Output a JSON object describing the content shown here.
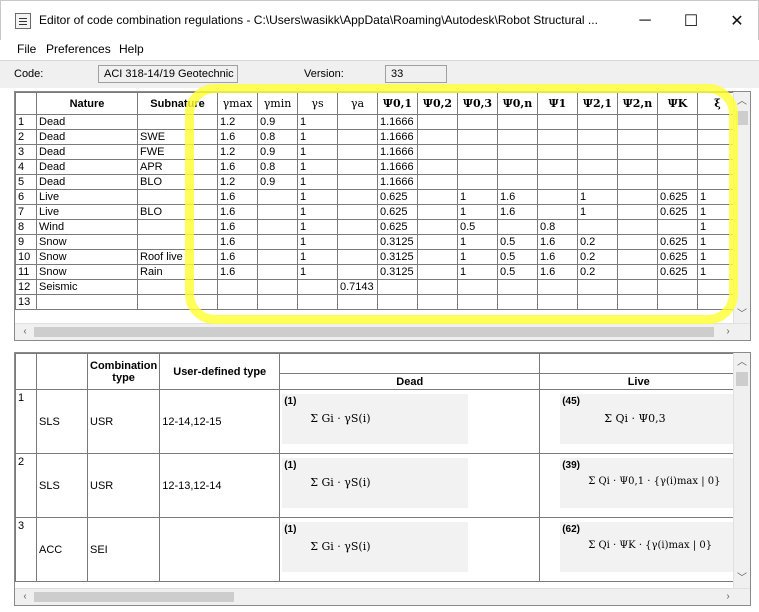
{
  "window": {
    "title": "Editor of code combination regulations - C:\\Users\\wasikk\\AppData\\Roaming\\Autodesk\\Robot Structural ...",
    "minimize": "─",
    "maximize": "☐",
    "close": "✕"
  },
  "menu": [
    "File",
    "Preferences",
    "Help"
  ],
  "code": {
    "label": "Code:",
    "value": "ACI 318-14/19 Geotechnic",
    "version_label": "Version:",
    "version_value": "33"
  },
  "top_table": {
    "headers": [
      "Nature",
      "Subnature",
      "γmax",
      "γmin",
      "γs",
      "γa",
      "Ψ0,1",
      "Ψ0,2",
      "Ψ0,3",
      "Ψ0,n",
      "Ψ1",
      "Ψ2,1",
      "Ψ2,n",
      "ΨK",
      "ξ"
    ],
    "rows": [
      [
        "1",
        "Dead",
        "",
        "1.2",
        "0.9",
        "1",
        "",
        "1.1666",
        "",
        "",
        "",
        "",
        "",
        "",
        "",
        ""
      ],
      [
        "2",
        "Dead",
        "SWE",
        "1.6",
        "0.8",
        "1",
        "",
        "1.1666",
        "",
        "",
        "",
        "",
        "",
        "",
        "",
        ""
      ],
      [
        "3",
        "Dead",
        "FWE",
        "1.2",
        "0.9",
        "1",
        "",
        "1.1666",
        "",
        "",
        "",
        "",
        "",
        "",
        "",
        ""
      ],
      [
        "4",
        "Dead",
        "APR",
        "1.6",
        "0.8",
        "1",
        "",
        "1.1666",
        "",
        "",
        "",
        "",
        "",
        "",
        "",
        ""
      ],
      [
        "5",
        "Dead",
        "BLO",
        "1.2",
        "0.9",
        "1",
        "",
        "1.1666",
        "",
        "",
        "",
        "",
        "",
        "",
        "",
        ""
      ],
      [
        "6",
        "Live",
        "",
        "1.6",
        "",
        "1",
        "",
        "0.625",
        "",
        "1",
        "1.6",
        "",
        "1",
        "",
        "0.625",
        "1"
      ],
      [
        "7",
        "Live",
        "BLO",
        "1.6",
        "",
        "1",
        "",
        "0.625",
        "",
        "1",
        "1.6",
        "",
        "1",
        "",
        "0.625",
        "1"
      ],
      [
        "8",
        "Wind",
        "",
        "1.6",
        "",
        "1",
        "",
        "0.625",
        "",
        "0.5",
        "",
        "0.8",
        "",
        "",
        "",
        "1"
      ],
      [
        "9",
        "Snow",
        "",
        "1.6",
        "",
        "1",
        "",
        "0.3125",
        "",
        "1",
        "0.5",
        "1.6",
        "0.2",
        "",
        "0.625",
        "1"
      ],
      [
        "10",
        "Snow",
        "Roof live",
        "1.6",
        "",
        "1",
        "",
        "0.3125",
        "",
        "1",
        "0.5",
        "1.6",
        "0.2",
        "",
        "0.625",
        "1"
      ],
      [
        "11",
        "Snow",
        "Rain",
        "1.6",
        "",
        "1",
        "",
        "0.3125",
        "",
        "1",
        "0.5",
        "1.6",
        "0.2",
        "",
        "0.625",
        "1"
      ],
      [
        "12",
        "Seismic",
        "",
        "",
        "",
        "",
        "0.7143",
        "",
        "",
        "",
        "",
        "",
        "",
        "",
        "",
        ""
      ],
      [
        "13",
        "",
        "",
        "",
        "",
        "",
        "",
        "",
        "",
        "",
        "",
        "",
        "",
        "",
        "",
        ""
      ]
    ]
  },
  "bottom_table": {
    "headers": [
      "Combination type",
      "User-defined type",
      "Dead",
      "Live"
    ],
    "rows": [
      {
        "num": "1",
        "type": "SLS",
        "comb": "USR",
        "user": "12-14,12-15",
        "dead_no": "(1)",
        "dead_formula": "Σ Gi · γS(i)",
        "live_no": "(45)",
        "live_formula": "Σ Qi · Ψ0,3"
      },
      {
        "num": "2",
        "type": "SLS",
        "comb": "USR",
        "user": "12-13,12-14",
        "dead_no": "(1)",
        "dead_formula": "Σ Gi · γS(i)",
        "live_no": "(39)",
        "live_formula": "Σ Qi · Ψ0,1 · {γ(i)max | 0}"
      },
      {
        "num": "3",
        "type": "ACC",
        "comb": "SEI",
        "user": "",
        "dead_no": "(1)",
        "dead_formula": "Σ Gi · γS(i)",
        "live_no": "(62)",
        "live_formula": "Σ Qi · ΨK · {γ(i)max | 0}"
      }
    ]
  },
  "highlight_color": "#ffff33"
}
